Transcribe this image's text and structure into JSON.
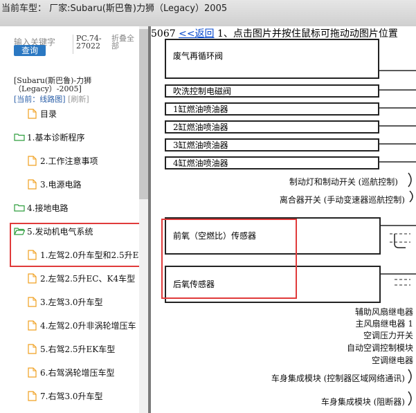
{
  "header": {
    "title": "当前车型：   厂家:Subaru(斯巴鲁)力狮（Legacy）2005"
  },
  "sidebar": {
    "search_placeholder": "输入关键字",
    "query_label": "查询",
    "pc_code": "PC.74-27022",
    "fold_all": "折叠全部",
    "model_text": "[Subaru(斯巴鲁)-力狮（Legacy）-2005]",
    "current_label": "[当前：线路图]",
    "refresh_label": "[刷新]",
    "items": [
      {
        "label": "目录",
        "icon": "page-icon",
        "indent": 1
      },
      {
        "label": "1.基本诊断程序",
        "icon": "folder-icon",
        "indent": 0
      },
      {
        "label": "2.工作注意事项",
        "icon": "page-icon",
        "indent": 1
      },
      {
        "label": "3.电源电路",
        "icon": "page-icon",
        "indent": 1
      },
      {
        "label": "4.接地电路",
        "icon": "folder-icon",
        "indent": 0
      },
      {
        "label": "5.发动机电气系统",
        "icon": "folder-open-icon",
        "indent": 0
      },
      {
        "label": "1.左驾2.0升车型和2.5升E",
        "icon": "page-icon",
        "indent": 1
      },
      {
        "label": "2.左驾2.5升EC、K4车型",
        "icon": "page-icon",
        "indent": 1
      },
      {
        "label": "3.左驾3.0升车型",
        "icon": "page-icon",
        "indent": 1
      },
      {
        "label": "4.左驾2.0升非涡轮增压车",
        "icon": "page-icon",
        "indent": 1
      },
      {
        "label": "5.右驾2.5升EK车型",
        "icon": "page-icon",
        "indent": 1
      },
      {
        "label": "6.右驾涡轮增压车型",
        "icon": "page-icon",
        "indent": 1
      },
      {
        "label": "7.右驾3.0升车型",
        "icon": "page-icon",
        "indent": 1
      }
    ]
  },
  "diagram": {
    "page_num": "5067",
    "back_label": "<<返回",
    "instruction": "1、点击图片并按住鼠标可拖动动图片位置",
    "boxes": [
      "废气再循环阀",
      "吹洗控制电磁阀",
      "1缸燃油喷油器",
      "2缸燃油喷油器",
      "3缸燃油喷油器",
      "4缸燃油喷油器",
      "前氧（空燃比）传感器",
      "后氧传感器"
    ],
    "right_labels": [
      "制动灯和制动开关 (巡航控制)",
      "离合器开关 (手动变速器巡航控制)",
      "辅助风扇继电器",
      "主风扇继电器 1",
      "空调压力开关",
      "自动空调控制模块",
      "空调继电器",
      "车身集成模块 (控制器区域网络通讯)",
      "车身集成模块 (阻断器)"
    ]
  },
  "colors": {
    "highlight": "#e03a3a",
    "query_button": "#2b78c2",
    "link": "#0044cc",
    "folder": "#2e9e3e",
    "page_icon": "#f0a020"
  }
}
